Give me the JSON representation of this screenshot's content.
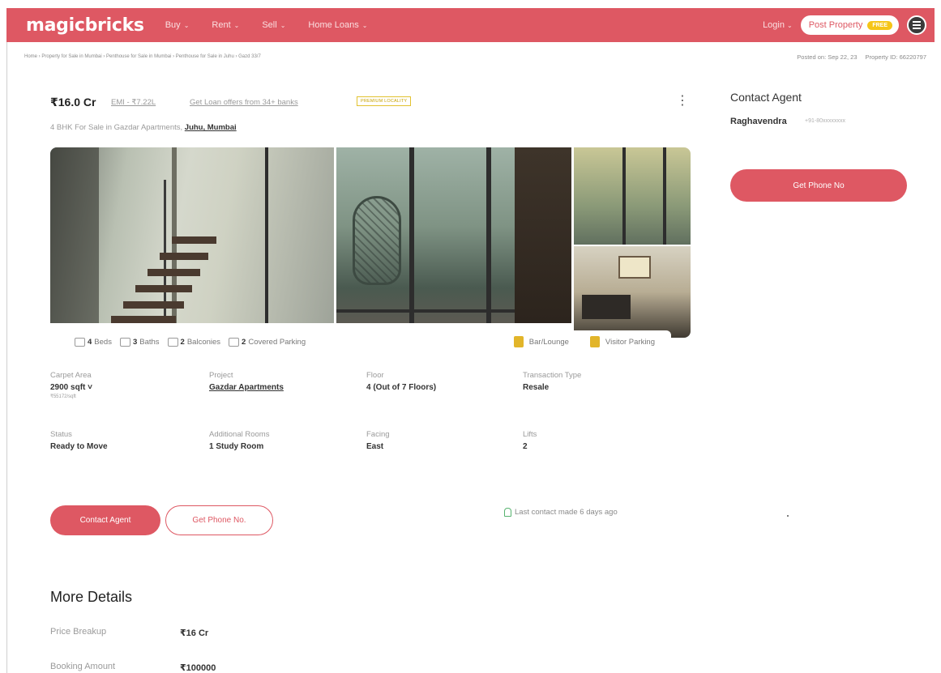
{
  "header": {
    "logo": "magicbricks",
    "nav": [
      {
        "label": "Buy",
        "chevron": "⌄"
      },
      {
        "label": "Rent",
        "chevron": "⌄"
      },
      {
        "label": "Sell",
        "chevron": "⌄"
      },
      {
        "label": "Home Loans",
        "chevron": "⌄"
      }
    ],
    "login": "Login",
    "post_property": "Post Property",
    "free_badge": "FREE",
    "brand_color": "#de5863"
  },
  "breadcrumb": "Home › Property for Sale in Mumbai › Penthouse for Sale in Mumbai › Penthouse for Sale in Juhu › Gazd 33/7",
  "posted": {
    "date": "Posted on: Sep 22, 23",
    "property_id": "Property ID: 66220797"
  },
  "listing": {
    "price": "₹16.0 Cr",
    "emi": "EMI - ₹7.22L",
    "loan_offers": "Get Loan offers from 34+ banks",
    "locality_badge": "PREMIUM LOCALITY",
    "kebab": "⋮",
    "subtitle_prefix": "4 BHK For Sale in Gazdar Apartments,",
    "subtitle_location": "Juhu, Mumbai"
  },
  "amenities": {
    "beds_count": "4",
    "beds": "Beds",
    "baths_count": "3",
    "baths": "Baths",
    "balconies_count": "2",
    "balconies": "Balconies",
    "parking_count": "2",
    "parking": "Covered Parking",
    "bar": "Bar/Lounge",
    "visitor": "Visitor Parking"
  },
  "details": {
    "carpet_label": "Carpet Area",
    "carpet_value": "2900 sqft ˅",
    "carpet_sub": "₹55172/sqft",
    "project_label": "Project",
    "project_value": "Gazdar Apartments",
    "floor_label": "Floor",
    "floor_value": "4 (Out of 7 Floors)",
    "transaction_label": "Transaction Type",
    "transaction_value": "Resale",
    "status_label": "Status",
    "status_value": "Ready to Move",
    "rooms_label": "Additional Rooms",
    "rooms_value": "1 Study Room",
    "facing_label": "Facing",
    "facing_value": "East",
    "lifts_label": "Lifts",
    "lifts_value": "2"
  },
  "actions": {
    "contact_agent": "Contact Agent",
    "get_phone": "Get Phone No.",
    "last_contact": "Last contact made 6 days ago"
  },
  "more_details": {
    "title": "More Details",
    "rows": [
      {
        "label": "Price Breakup",
        "value": "₹16 Cr"
      },
      {
        "label": "Booking Amount",
        "value": "₹100000"
      }
    ]
  },
  "contact_card": {
    "title": "Contact Agent",
    "agent": "Raghavendra",
    "phone_masked": "+91-80xxxxxxxx",
    "get_phone": "Get Phone No"
  }
}
